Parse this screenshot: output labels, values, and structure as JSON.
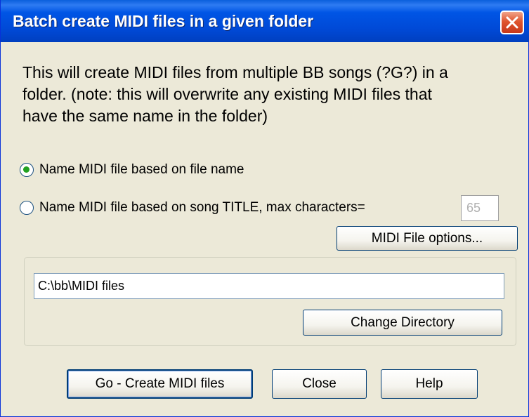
{
  "dialog": {
    "title": "Batch create MIDI files in a given folder",
    "description_lines": [
      "This will create MIDI files from multiple BB songs (?G?) in a",
      "folder.  (note: this will overwrite any existing MIDI files that",
      "have the same name in the folder)"
    ]
  },
  "naming": {
    "option_filename_label": "Name MIDI file based on file name",
    "option_filename_selected": true,
    "option_title_label": "Name MIDI file based on song TITLE, max characters=",
    "option_title_selected": false,
    "max_characters_value": "65"
  },
  "buttons": {
    "midi_options_label": "MIDI File options...",
    "change_directory_label": "Change Directory",
    "go_label": "Go - Create MIDI files",
    "close_label": "Close",
    "help_label": "Help"
  },
  "directory": {
    "path": "C:\\bb\\MIDI files"
  },
  "colors": {
    "titlebar": "#0055e5",
    "window_bg": "#ece9d8",
    "close_button": "#e0552e",
    "radio_dot": "#21a121"
  },
  "icons": {
    "close": "close-icon"
  }
}
